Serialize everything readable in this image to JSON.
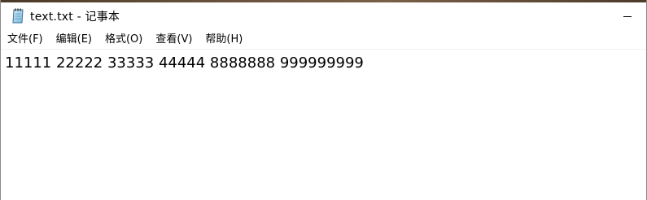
{
  "window": {
    "title": "text.txt - 记事本",
    "icon": "notepad-icon",
    "controls": {
      "minimize": "minimize-icon"
    }
  },
  "menu": {
    "items": [
      {
        "label": "文件(F)"
      },
      {
        "label": "编辑(E)"
      },
      {
        "label": "格式(O)"
      },
      {
        "label": "查看(V)"
      },
      {
        "label": "帮助(H)"
      }
    ]
  },
  "editor": {
    "content": "11111 22222 33333 44444 8888888 999999999"
  },
  "colors": {
    "background": "#ffffff",
    "text": "#000000",
    "menu_hover": "#e5f1fb"
  }
}
